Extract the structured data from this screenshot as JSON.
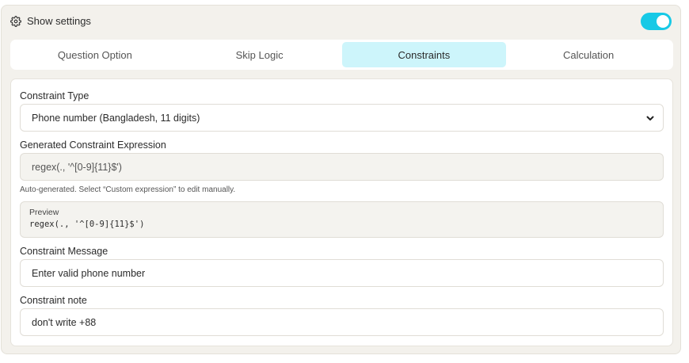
{
  "header": {
    "title": "Show settings",
    "toggle_on": true,
    "accent": "#17c9e6"
  },
  "tabs": [
    {
      "label": "Question Option",
      "active": false
    },
    {
      "label": "Skip Logic",
      "active": false
    },
    {
      "label": "Constraints",
      "active": true
    },
    {
      "label": "Calculation",
      "active": false
    }
  ],
  "form": {
    "constraint_type": {
      "label": "Constraint Type",
      "selected": "Phone number (Bangladesh, 11 digits)"
    },
    "expression": {
      "label": "Generated Constraint Expression",
      "value": "regex(., '^[0-9]{11}$')",
      "hint": "Auto-generated. Select “Custom expression” to edit manually."
    },
    "preview": {
      "title": "Preview",
      "code": "regex(., '^[0-9]{11}$')"
    },
    "message": {
      "label": "Constraint Message",
      "value": "Enter valid phone number"
    },
    "note": {
      "label": "Constraint note",
      "value": "don't write +88"
    }
  }
}
